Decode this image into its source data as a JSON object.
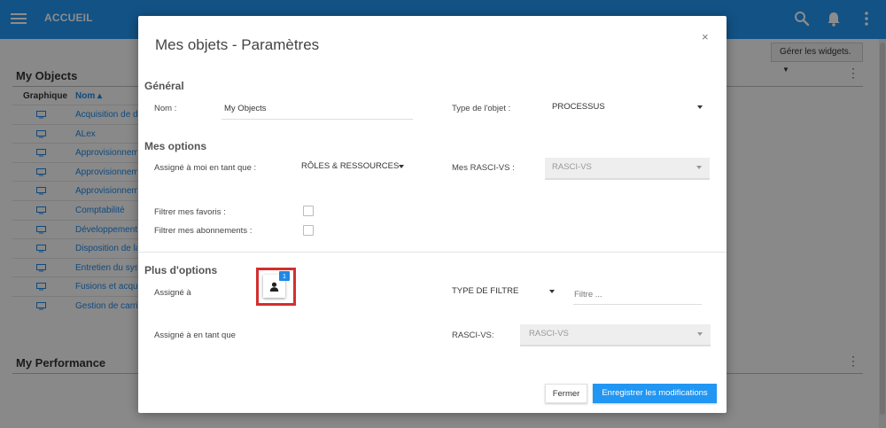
{
  "topbar": {
    "title": "ACCUEIL"
  },
  "background": {
    "manage_widgets_label": "Gérer les widgets.",
    "my_objects": {
      "title": "My Objects",
      "columns": [
        "Graphique",
        "Nom ▴"
      ],
      "rows": [
        "Acquisition de de",
        "ALex",
        "Approvisionneme",
        "Approvisionneme",
        "Approvisionneme",
        "Comptabilité",
        "Développement d",
        "Disposition de la",
        "Entretien du syst",
        "Fusions et acqui",
        "Gestion de carriè"
      ]
    },
    "my_performance": {
      "title": "My Performance"
    }
  },
  "modal": {
    "title": "Mes objets - Paramètres",
    "close": "×",
    "general": {
      "heading": "Général",
      "name_label": "Nom :",
      "name_value": "My Objects",
      "type_label": "Type de l'objet :",
      "type_value": "PROCESSUS"
    },
    "my_options": {
      "heading": "Mes options",
      "assigned_label": "Assigné à moi en tant que :",
      "assigned_value": "RÔLES & RESSOURCES",
      "rasci_label": "Mes RASCI-VS :",
      "rasci_value": "RASCI-VS",
      "filter_fav_label": "Filtrer mes favoris :",
      "filter_sub_label": "Filtrer mes abonnements :"
    },
    "more_options": {
      "heading": "Plus d'options",
      "assigned_to_label": "Assigné à",
      "assigned_count": "1",
      "filter_type_value": "TYPE DE FILTRE",
      "filter_placeholder": "Filtre ...",
      "assigned_as_label": "Assigné à en tant que",
      "rasci_label": "RASCI-VS:",
      "rasci_value": "RASCI-VS"
    },
    "buttons": {
      "close": "Fermer",
      "save": "Enregistrer les modifications"
    }
  }
}
